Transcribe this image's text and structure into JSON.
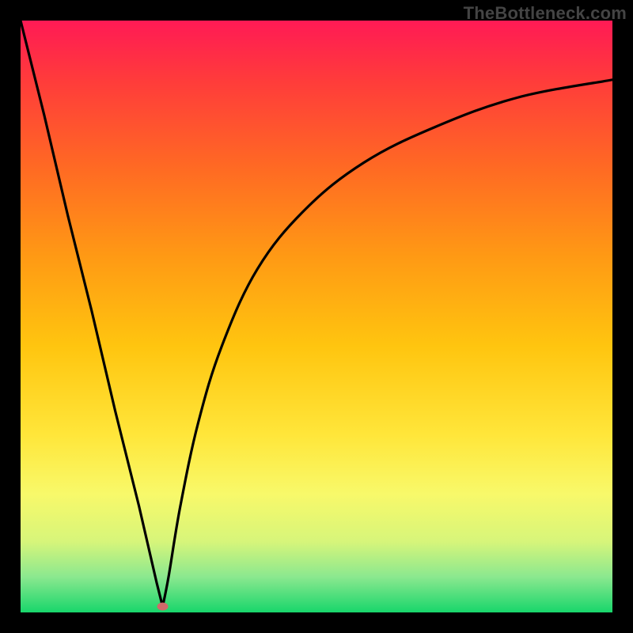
{
  "watermark": "TheBottleneck.com",
  "chart_data": {
    "type": "line",
    "title": "",
    "xlabel": "",
    "ylabel": "",
    "xlim": [
      0,
      100
    ],
    "ylim": [
      0,
      100
    ],
    "grid": false,
    "legend": false,
    "background_gradient": {
      "stops": [
        {
          "offset": 0.0,
          "color": "#ff1a55"
        },
        {
          "offset": 0.1,
          "color": "#ff3b3b"
        },
        {
          "offset": 0.25,
          "color": "#ff6a23"
        },
        {
          "offset": 0.4,
          "color": "#ff9a14"
        },
        {
          "offset": 0.55,
          "color": "#ffc50f"
        },
        {
          "offset": 0.7,
          "color": "#ffe63a"
        },
        {
          "offset": 0.8,
          "color": "#f8f96a"
        },
        {
          "offset": 0.88,
          "color": "#d7f57a"
        },
        {
          "offset": 0.94,
          "color": "#8be88f"
        },
        {
          "offset": 1.0,
          "color": "#18d66b"
        }
      ]
    },
    "curve": {
      "description": "Bottleneck percentage curve. Two branches meeting at a cusp minimum.",
      "minimum": {
        "x": 24,
        "y": 1
      },
      "left_branch": {
        "comment": "Nearly straight descent from top-left corner to the cusp.",
        "points": [
          {
            "x": 0,
            "y": 100
          },
          {
            "x": 4,
            "y": 84
          },
          {
            "x": 8,
            "y": 67
          },
          {
            "x": 12,
            "y": 51
          },
          {
            "x": 16,
            "y": 34
          },
          {
            "x": 20,
            "y": 18
          },
          {
            "x": 23,
            "y": 5
          },
          {
            "x": 24,
            "y": 1
          }
        ]
      },
      "right_branch": {
        "comment": "Steep rise from cusp, decelerating toward upper right.",
        "points": [
          {
            "x": 24,
            "y": 1
          },
          {
            "x": 25,
            "y": 6
          },
          {
            "x": 27,
            "y": 18
          },
          {
            "x": 30,
            "y": 32
          },
          {
            "x": 34,
            "y": 45
          },
          {
            "x": 40,
            "y": 58
          },
          {
            "x": 48,
            "y": 68
          },
          {
            "x": 58,
            "y": 76
          },
          {
            "x": 70,
            "y": 82
          },
          {
            "x": 84,
            "y": 87
          },
          {
            "x": 100,
            "y": 90
          }
        ]
      }
    },
    "marker": {
      "x": 24,
      "y": 1,
      "color": "#d06a6a",
      "rx": 7,
      "ry": 5
    }
  }
}
